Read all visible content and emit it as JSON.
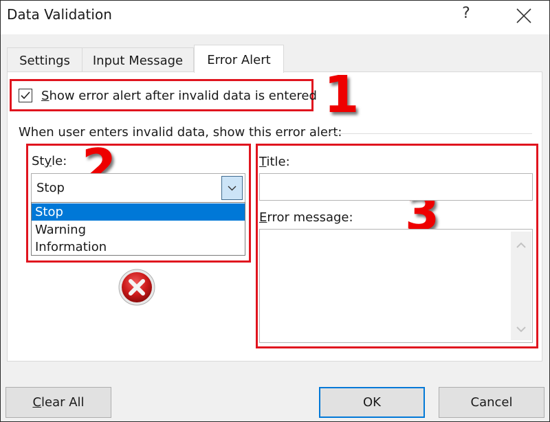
{
  "window": {
    "title": "Data Validation",
    "help_label": "?",
    "close_icon": "close-icon"
  },
  "tabs": [
    {
      "label": "Settings",
      "active": false
    },
    {
      "label": "Input Message",
      "active": false
    },
    {
      "label": "Error Alert",
      "active": true
    }
  ],
  "error_alert": {
    "show_alert": {
      "checked": true,
      "label_mnemonic": "S",
      "label_rest": "how error alert after invalid data is entered"
    },
    "section_label": "When user enters invalid data, show this error alert:",
    "style": {
      "label_pre": "St",
      "label_mnemonic": "y",
      "label_post": "le:",
      "selected": "Stop",
      "options": [
        "Stop",
        "Warning",
        "Information"
      ],
      "icon": "stop-error-icon"
    },
    "title_field": {
      "label_mnemonic": "T",
      "label_rest": "itle:",
      "value": ""
    },
    "error_message_field": {
      "label_mnemonic": "E",
      "label_rest": "rror message:",
      "value": ""
    }
  },
  "annotations": {
    "markers": [
      "1",
      "2",
      "3"
    ],
    "color": "#e0141e"
  },
  "footer": {
    "clear_all_mnemonic": "C",
    "clear_all_rest": "lear All",
    "ok_label": "OK",
    "cancel_label": "Cancel"
  }
}
